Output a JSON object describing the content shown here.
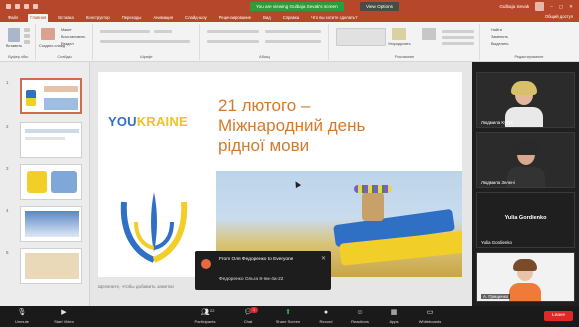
{
  "titlebar": {
    "share_banner": "You are viewing Gulbaja Sevak's screen",
    "view_options": "View Options",
    "user": "Gulbaja Sevak"
  },
  "menu": {
    "tabs": [
      "Файл",
      "Главная",
      "Вставка",
      "Конструктор",
      "Переходы",
      "Анимация",
      "Слайд-шоу",
      "Рецензирование",
      "Вид",
      "Справка",
      "Что вы хотите сделать?"
    ],
    "active_index": 1,
    "share": "Общий доступ"
  },
  "ribbon": {
    "paste": "Вставить",
    "new_slide": "Создать слайд",
    "groups": [
      "Буфер обм.",
      "Слайды",
      "Шрифт",
      "Абзац",
      "Рисование",
      "Редактирование"
    ],
    "slide_items": [
      "Макет",
      "Восстановить",
      "Раздел"
    ],
    "arrange": "Упорядочить",
    "edit_items": [
      "Найти",
      "Заменить",
      "Выделить"
    ]
  },
  "slides": {
    "numbers": [
      "1",
      "2",
      "3",
      "4",
      "5"
    ],
    "active": "1"
  },
  "slide": {
    "logo_you": "YOU",
    "logo_kraine": "KRAINE",
    "title_line1": "21 лютого –",
    "title_line2": "Міжнародний день",
    "title_line3": "рідної мови",
    "notes_placeholder": "Щелкните, чтобы добавить заметки"
  },
  "chat_popup": {
    "from": "From Оля Федоренко to Everyone",
    "message": "Федоренко Ольга 8-ям-4а-22"
  },
  "participants": [
    {
      "name": "Людмила Kyzyk",
      "display": ""
    },
    {
      "name": "Людмила Зелені",
      "display": ""
    },
    {
      "name": "Yulia Gordienko",
      "display": "Yulia Gordienko"
    },
    {
      "name": "А. Грищенко",
      "display": ""
    }
  ],
  "toolbar": {
    "unmute": "Unmute",
    "start_video": "Start Video",
    "participants": "Participants",
    "participants_count": "22",
    "chat": "Chat",
    "chat_badge": "1",
    "share_screen": "Share Screen",
    "record": "Record",
    "reactions": "Reactions",
    "apps": "Apps",
    "whiteboards": "Whiteboards",
    "leave": "Leave"
  },
  "colors": {
    "accent": "#b7472a",
    "share_green": "#2e9c3d",
    "leave_red": "#e02828",
    "title_orange": "#d47a2a",
    "ukraine_blue": "#2f6fc4",
    "ukraine_yellow": "#f2cf28"
  }
}
